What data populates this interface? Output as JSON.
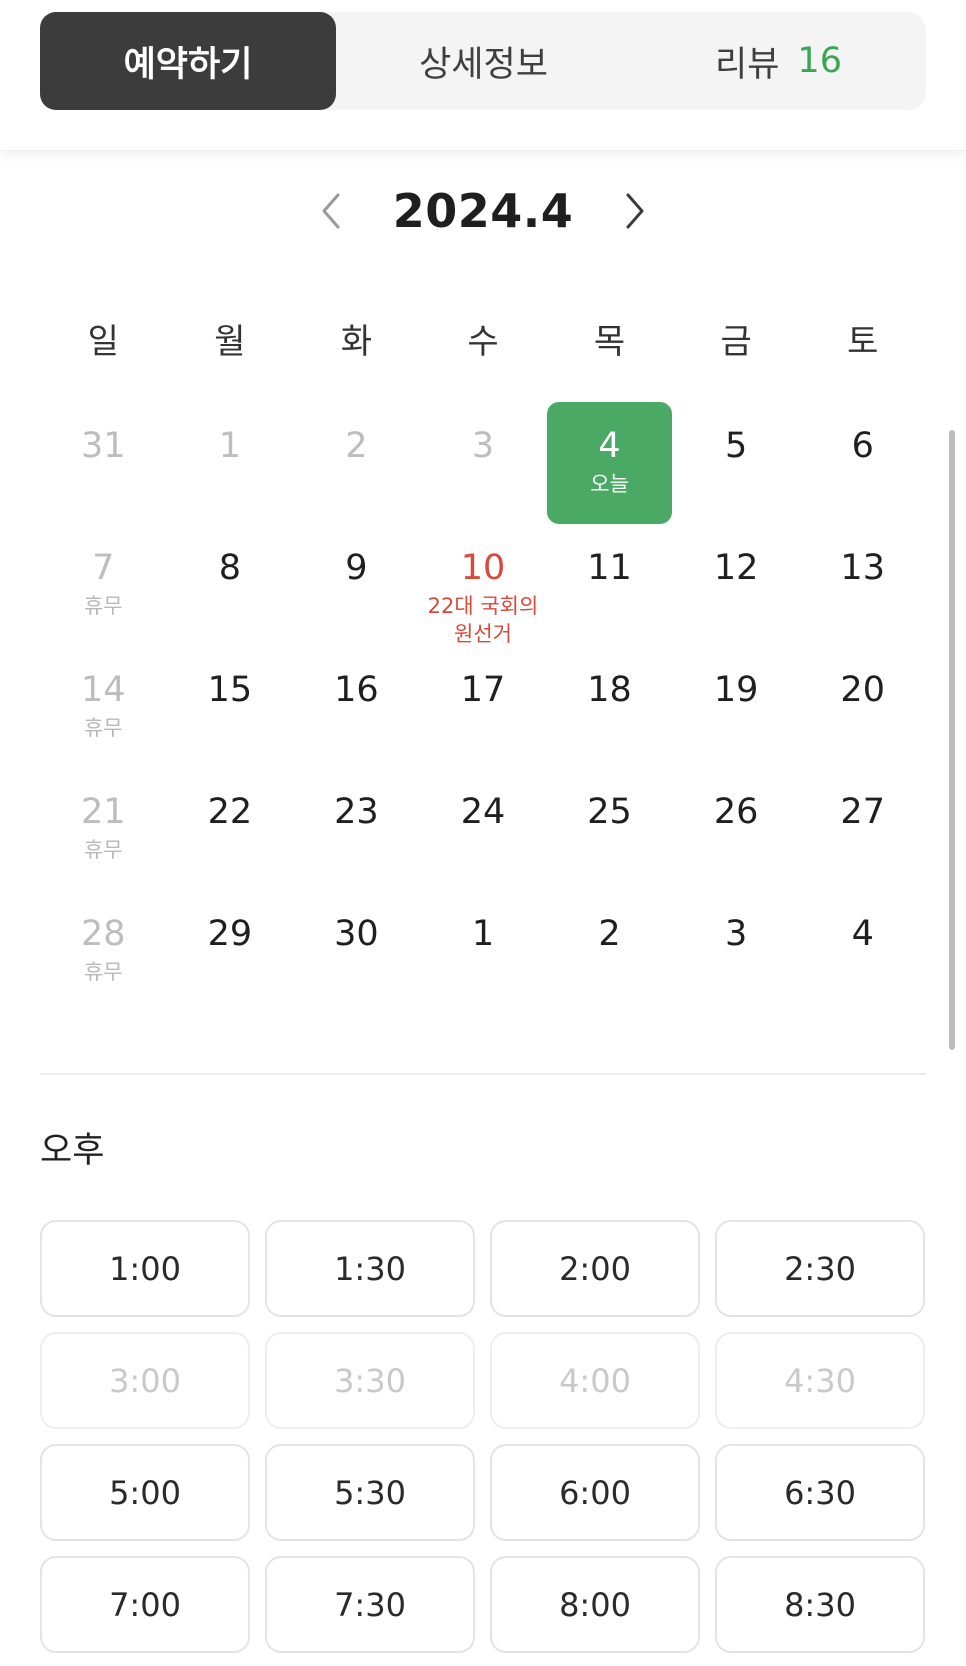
{
  "tabs": [
    {
      "label": "예약하기",
      "active": true
    },
    {
      "label": "상세정보",
      "active": false
    },
    {
      "label": "리뷰",
      "count": "16",
      "active": false
    }
  ],
  "calendar": {
    "month_label": "2024.4",
    "weekdays": [
      "일",
      "월",
      "화",
      "수",
      "목",
      "금",
      "토"
    ],
    "weeks": [
      [
        {
          "day": "31",
          "muted": true
        },
        {
          "day": "1",
          "muted": true
        },
        {
          "day": "2",
          "muted": true
        },
        {
          "day": "3",
          "muted": true
        },
        {
          "day": "4",
          "today": true,
          "note": "오늘"
        },
        {
          "day": "5"
        },
        {
          "day": "6"
        }
      ],
      [
        {
          "day": "7",
          "muted": true,
          "note": "휴무"
        },
        {
          "day": "8"
        },
        {
          "day": "9"
        },
        {
          "day": "10",
          "holiday": true,
          "note": "22대 국회의\n원선거"
        },
        {
          "day": "11"
        },
        {
          "day": "12"
        },
        {
          "day": "13"
        }
      ],
      [
        {
          "day": "14",
          "muted": true,
          "note": "휴무"
        },
        {
          "day": "15"
        },
        {
          "day": "16"
        },
        {
          "day": "17"
        },
        {
          "day": "18"
        },
        {
          "day": "19"
        },
        {
          "day": "20"
        }
      ],
      [
        {
          "day": "21",
          "muted": true,
          "note": "휴무"
        },
        {
          "day": "22"
        },
        {
          "day": "23"
        },
        {
          "day": "24"
        },
        {
          "day": "25"
        },
        {
          "day": "26"
        },
        {
          "day": "27"
        }
      ],
      [
        {
          "day": "28",
          "muted": true,
          "note": "휴무"
        },
        {
          "day": "29"
        },
        {
          "day": "30"
        },
        {
          "day": "1"
        },
        {
          "day": "2"
        },
        {
          "day": "3"
        },
        {
          "day": "4"
        }
      ]
    ]
  },
  "time_section": {
    "label": "오후",
    "slots": [
      {
        "time": "1:00",
        "available": true
      },
      {
        "time": "1:30",
        "available": true
      },
      {
        "time": "2:00",
        "available": true
      },
      {
        "time": "2:30",
        "available": true
      },
      {
        "time": "3:00",
        "available": false
      },
      {
        "time": "3:30",
        "available": false
      },
      {
        "time": "4:00",
        "available": false
      },
      {
        "time": "4:30",
        "available": false
      },
      {
        "time": "5:00",
        "available": true
      },
      {
        "time": "5:30",
        "available": true
      },
      {
        "time": "6:00",
        "available": true
      },
      {
        "time": "6:30",
        "available": true
      },
      {
        "time": "7:00",
        "available": true
      },
      {
        "time": "7:30",
        "available": true
      },
      {
        "time": "8:00",
        "available": true
      },
      {
        "time": "8:30",
        "available": true
      }
    ]
  },
  "colors": {
    "accent_green": "#4aa964",
    "holiday_red": "#d94a3c",
    "active_tab_bg": "#3c3c3c",
    "review_count": "#3aa653"
  },
  "icons": {
    "prev_month": "chevron-left-icon",
    "next_month": "chevron-right-icon"
  }
}
